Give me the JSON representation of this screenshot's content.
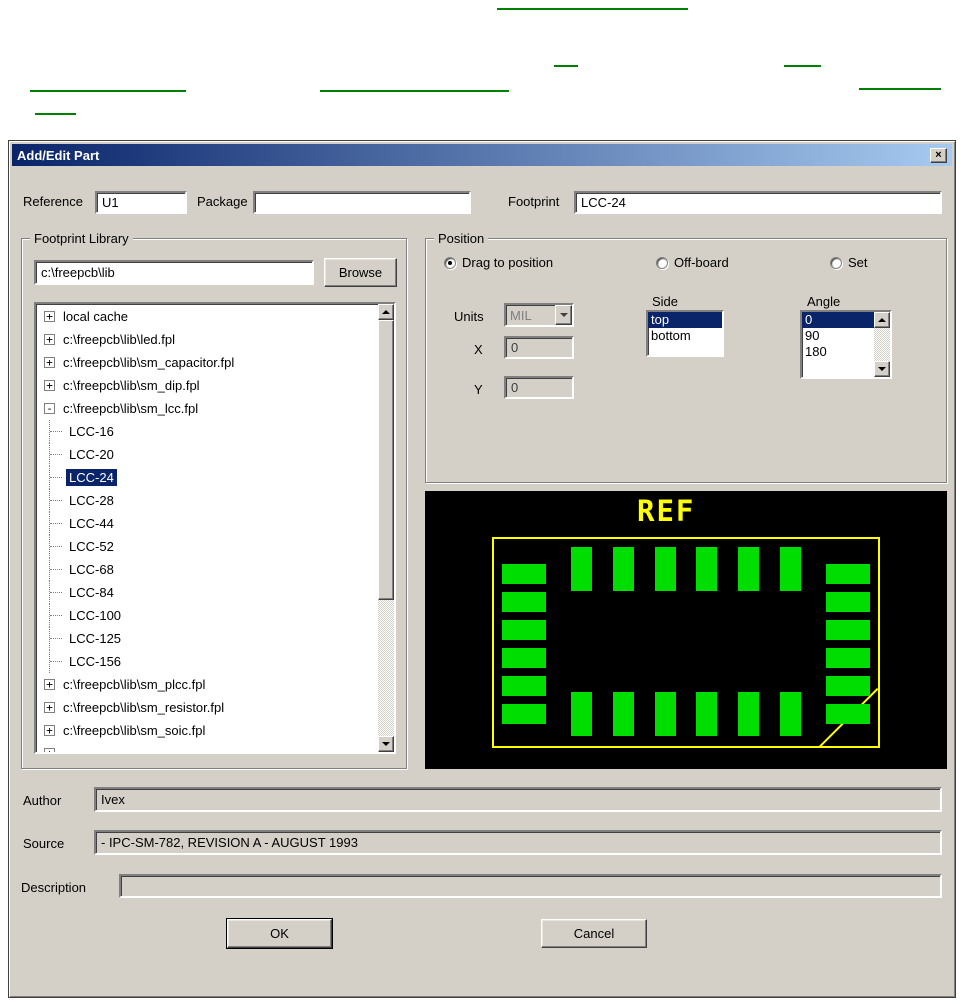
{
  "theme": {
    "selection_blue": "#0a246a",
    "titlebar_gradient_left": "#0a246a",
    "titlebar_gradient_right": "#a6caf0",
    "link_green": "#008000",
    "dialog_gray": "#d4d0c8"
  },
  "dialog": {
    "title": "Add/Edit Part",
    "titlebar": {
      "close_icon": "×"
    },
    "fields": {
      "reference": {
        "label": "Reference",
        "value": "U1"
      },
      "package": {
        "label": "Package",
        "value": ""
      },
      "footprint": {
        "label": "Footprint",
        "value": "LCC-24"
      }
    },
    "library": {
      "group_label": "Footprint Library",
      "path_value": "c:\\freepcb\\lib",
      "browse_label": "Browse",
      "tree": [
        {
          "label": "local cache",
          "type": "root",
          "state": "collapsed"
        },
        {
          "label": "c:\\freepcb\\lib\\led.fpl",
          "type": "root",
          "state": "collapsed"
        },
        {
          "label": "c:\\freepcb\\lib\\sm_capacitor.fpl",
          "type": "root",
          "state": "collapsed"
        },
        {
          "label": "c:\\freepcb\\lib\\sm_dip.fpl",
          "type": "root",
          "state": "collapsed"
        },
        {
          "label": "c:\\freepcb\\lib\\sm_lcc.fpl",
          "type": "root",
          "state": "expanded"
        },
        {
          "label": "LCC-16",
          "type": "child"
        },
        {
          "label": "LCC-20",
          "type": "child"
        },
        {
          "label": "LCC-24",
          "type": "child",
          "selected": true
        },
        {
          "label": "LCC-28",
          "type": "child"
        },
        {
          "label": "LCC-44",
          "type": "child"
        },
        {
          "label": "LCC-52",
          "type": "child"
        },
        {
          "label": "LCC-68",
          "type": "child"
        },
        {
          "label": "LCC-84",
          "type": "child"
        },
        {
          "label": "LCC-100",
          "type": "child"
        },
        {
          "label": "LCC-125",
          "type": "child"
        },
        {
          "label": "LCC-156",
          "type": "child"
        },
        {
          "label": "c:\\freepcb\\lib\\sm_plcc.fpl",
          "type": "root",
          "state": "collapsed"
        },
        {
          "label": "c:\\freepcb\\lib\\sm_resistor.fpl",
          "type": "root",
          "state": "collapsed"
        },
        {
          "label": "c:\\freepcb\\lib\\sm_soic.fpl",
          "type": "root",
          "state": "collapsed"
        },
        {
          "label": "",
          "type": "root",
          "state": "collapsed"
        }
      ]
    },
    "position": {
      "group_label": "Position",
      "radios": [
        {
          "label": "Drag to position",
          "selected": true
        },
        {
          "label": "Off-board",
          "selected": false
        },
        {
          "label": "Set",
          "selected": false
        }
      ],
      "units": {
        "label": "Units",
        "value": "MIL",
        "disabled": true
      },
      "side": {
        "label": "Side",
        "options": [
          "top",
          "bottom"
        ],
        "selected": "top"
      },
      "angle": {
        "label": "Angle",
        "options": [
          "0",
          "90",
          "180"
        ],
        "selected": "0"
      },
      "x": {
        "label": "X",
        "value": "0",
        "disabled": true
      },
      "y": {
        "label": "Y",
        "value": "0",
        "disabled": true
      }
    },
    "preview": {
      "ref_label": "REF",
      "pads_per_side": 6,
      "pad_color": "#00dd00",
      "outline_color": "#ffff00",
      "background": "#000000"
    },
    "meta": {
      "author": {
        "label": "Author",
        "value": "Ivex"
      },
      "source": {
        "label": "Source",
        "value": "- IPC-SM-782, REVISION A - AUGUST 1993"
      },
      "description": {
        "label": "Description",
        "value": ""
      }
    },
    "buttons": {
      "ok": "OK",
      "cancel": "Cancel"
    }
  }
}
